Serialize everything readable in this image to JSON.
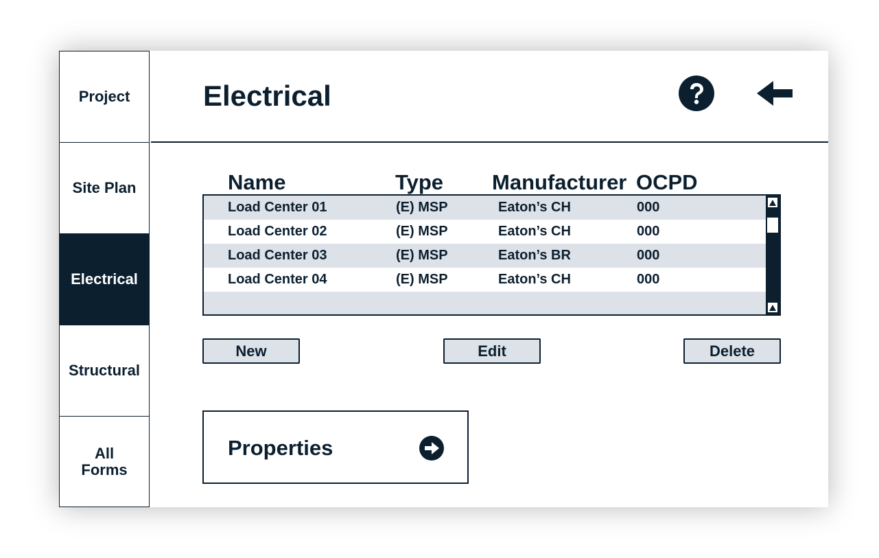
{
  "sidebar": {
    "items": [
      {
        "label": "Project",
        "active": false
      },
      {
        "label": "Site Plan",
        "active": false
      },
      {
        "label": "Electrical",
        "active": true
      },
      {
        "label": "Structural",
        "active": false
      },
      {
        "label": "All\nForms",
        "active": false
      }
    ]
  },
  "header": {
    "title": "Electrical",
    "help_icon": "question-circle-icon",
    "back_icon": "arrow-left-icon"
  },
  "table": {
    "columns": [
      "Name",
      "Type",
      "Manufacturer",
      "OCPD"
    ],
    "rows": [
      {
        "name": "Load Center 01",
        "type": "(E) MSP",
        "manufacturer": "Eaton’s CH",
        "ocpd": "000"
      },
      {
        "name": "Load Center 02",
        "type": "(E) MSP",
        "manufacturer": "Eaton’s CH",
        "ocpd": "000"
      },
      {
        "name": "Load Center 03",
        "type": "(E) MSP",
        "manufacturer": "Eaton’s BR",
        "ocpd": "000"
      },
      {
        "name": "Load Center 04",
        "type": "(E) MSP",
        "manufacturer": "Eaton’s CH",
        "ocpd": "000"
      }
    ]
  },
  "actions": {
    "new_label": "New",
    "edit_label": "Edit",
    "delete_label": "Delete"
  },
  "properties": {
    "label": "Properties",
    "icon": "arrow-right-circle-icon"
  },
  "colors": {
    "primary": "#0b1f2f",
    "row_shade": "#dde1e8",
    "background": "#ffffff"
  }
}
